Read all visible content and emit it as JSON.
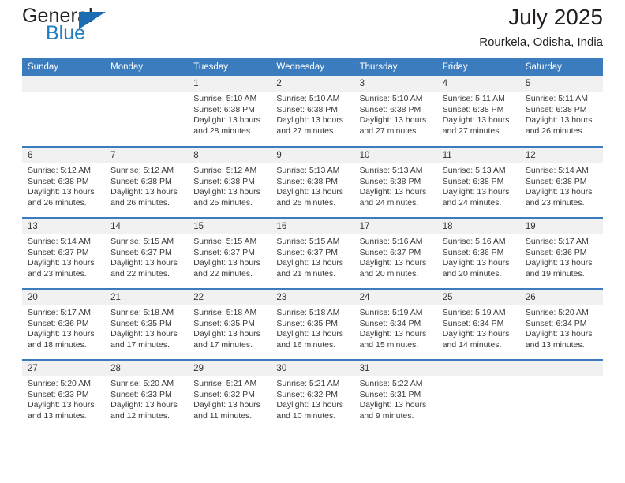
{
  "brand": {
    "name_top": "General",
    "name_bottom": "Blue",
    "triangle_color": "#1b6cb0",
    "blue_text_color": "#1f7dc0"
  },
  "header": {
    "title": "July 2025",
    "subtitle": "Rourkela, Odisha, India"
  },
  "theme": {
    "header_bg": "#3a7cbe",
    "daynum_bg": "#f1f1f1",
    "row_divider": "#3a7cbe",
    "text": "#3a3a3a"
  },
  "weekdays": [
    "Sunday",
    "Monday",
    "Tuesday",
    "Wednesday",
    "Thursday",
    "Friday",
    "Saturday"
  ],
  "weeks": [
    [
      {
        "day": "",
        "empty": true
      },
      {
        "day": "",
        "empty": true
      },
      {
        "day": "1",
        "sunrise": "Sunrise: 5:10 AM",
        "sunset": "Sunset: 6:38 PM",
        "daylight1": "Daylight: 13 hours",
        "daylight2": "and 28 minutes."
      },
      {
        "day": "2",
        "sunrise": "Sunrise: 5:10 AM",
        "sunset": "Sunset: 6:38 PM",
        "daylight1": "Daylight: 13 hours",
        "daylight2": "and 27 minutes."
      },
      {
        "day": "3",
        "sunrise": "Sunrise: 5:10 AM",
        "sunset": "Sunset: 6:38 PM",
        "daylight1": "Daylight: 13 hours",
        "daylight2": "and 27 minutes."
      },
      {
        "day": "4",
        "sunrise": "Sunrise: 5:11 AM",
        "sunset": "Sunset: 6:38 PM",
        "daylight1": "Daylight: 13 hours",
        "daylight2": "and 27 minutes."
      },
      {
        "day": "5",
        "sunrise": "Sunrise: 5:11 AM",
        "sunset": "Sunset: 6:38 PM",
        "daylight1": "Daylight: 13 hours",
        "daylight2": "and 26 minutes."
      }
    ],
    [
      {
        "day": "6",
        "sunrise": "Sunrise: 5:12 AM",
        "sunset": "Sunset: 6:38 PM",
        "daylight1": "Daylight: 13 hours",
        "daylight2": "and 26 minutes."
      },
      {
        "day": "7",
        "sunrise": "Sunrise: 5:12 AM",
        "sunset": "Sunset: 6:38 PM",
        "daylight1": "Daylight: 13 hours",
        "daylight2": "and 26 minutes."
      },
      {
        "day": "8",
        "sunrise": "Sunrise: 5:12 AM",
        "sunset": "Sunset: 6:38 PM",
        "daylight1": "Daylight: 13 hours",
        "daylight2": "and 25 minutes."
      },
      {
        "day": "9",
        "sunrise": "Sunrise: 5:13 AM",
        "sunset": "Sunset: 6:38 PM",
        "daylight1": "Daylight: 13 hours",
        "daylight2": "and 25 minutes."
      },
      {
        "day": "10",
        "sunrise": "Sunrise: 5:13 AM",
        "sunset": "Sunset: 6:38 PM",
        "daylight1": "Daylight: 13 hours",
        "daylight2": "and 24 minutes."
      },
      {
        "day": "11",
        "sunrise": "Sunrise: 5:13 AM",
        "sunset": "Sunset: 6:38 PM",
        "daylight1": "Daylight: 13 hours",
        "daylight2": "and 24 minutes."
      },
      {
        "day": "12",
        "sunrise": "Sunrise: 5:14 AM",
        "sunset": "Sunset: 6:38 PM",
        "daylight1": "Daylight: 13 hours",
        "daylight2": "and 23 minutes."
      }
    ],
    [
      {
        "day": "13",
        "sunrise": "Sunrise: 5:14 AM",
        "sunset": "Sunset: 6:37 PM",
        "daylight1": "Daylight: 13 hours",
        "daylight2": "and 23 minutes."
      },
      {
        "day": "14",
        "sunrise": "Sunrise: 5:15 AM",
        "sunset": "Sunset: 6:37 PM",
        "daylight1": "Daylight: 13 hours",
        "daylight2": "and 22 minutes."
      },
      {
        "day": "15",
        "sunrise": "Sunrise: 5:15 AM",
        "sunset": "Sunset: 6:37 PM",
        "daylight1": "Daylight: 13 hours",
        "daylight2": "and 22 minutes."
      },
      {
        "day": "16",
        "sunrise": "Sunrise: 5:15 AM",
        "sunset": "Sunset: 6:37 PM",
        "daylight1": "Daylight: 13 hours",
        "daylight2": "and 21 minutes."
      },
      {
        "day": "17",
        "sunrise": "Sunrise: 5:16 AM",
        "sunset": "Sunset: 6:37 PM",
        "daylight1": "Daylight: 13 hours",
        "daylight2": "and 20 minutes."
      },
      {
        "day": "18",
        "sunrise": "Sunrise: 5:16 AM",
        "sunset": "Sunset: 6:36 PM",
        "daylight1": "Daylight: 13 hours",
        "daylight2": "and 20 minutes."
      },
      {
        "day": "19",
        "sunrise": "Sunrise: 5:17 AM",
        "sunset": "Sunset: 6:36 PM",
        "daylight1": "Daylight: 13 hours",
        "daylight2": "and 19 minutes."
      }
    ],
    [
      {
        "day": "20",
        "sunrise": "Sunrise: 5:17 AM",
        "sunset": "Sunset: 6:36 PM",
        "daylight1": "Daylight: 13 hours",
        "daylight2": "and 18 minutes."
      },
      {
        "day": "21",
        "sunrise": "Sunrise: 5:18 AM",
        "sunset": "Sunset: 6:35 PM",
        "daylight1": "Daylight: 13 hours",
        "daylight2": "and 17 minutes."
      },
      {
        "day": "22",
        "sunrise": "Sunrise: 5:18 AM",
        "sunset": "Sunset: 6:35 PM",
        "daylight1": "Daylight: 13 hours",
        "daylight2": "and 17 minutes."
      },
      {
        "day": "23",
        "sunrise": "Sunrise: 5:18 AM",
        "sunset": "Sunset: 6:35 PM",
        "daylight1": "Daylight: 13 hours",
        "daylight2": "and 16 minutes."
      },
      {
        "day": "24",
        "sunrise": "Sunrise: 5:19 AM",
        "sunset": "Sunset: 6:34 PM",
        "daylight1": "Daylight: 13 hours",
        "daylight2": "and 15 minutes."
      },
      {
        "day": "25",
        "sunrise": "Sunrise: 5:19 AM",
        "sunset": "Sunset: 6:34 PM",
        "daylight1": "Daylight: 13 hours",
        "daylight2": "and 14 minutes."
      },
      {
        "day": "26",
        "sunrise": "Sunrise: 5:20 AM",
        "sunset": "Sunset: 6:34 PM",
        "daylight1": "Daylight: 13 hours",
        "daylight2": "and 13 minutes."
      }
    ],
    [
      {
        "day": "27",
        "sunrise": "Sunrise: 5:20 AM",
        "sunset": "Sunset: 6:33 PM",
        "daylight1": "Daylight: 13 hours",
        "daylight2": "and 13 minutes."
      },
      {
        "day": "28",
        "sunrise": "Sunrise: 5:20 AM",
        "sunset": "Sunset: 6:33 PM",
        "daylight1": "Daylight: 13 hours",
        "daylight2": "and 12 minutes."
      },
      {
        "day": "29",
        "sunrise": "Sunrise: 5:21 AM",
        "sunset": "Sunset: 6:32 PM",
        "daylight1": "Daylight: 13 hours",
        "daylight2": "and 11 minutes."
      },
      {
        "day": "30",
        "sunrise": "Sunrise: 5:21 AM",
        "sunset": "Sunset: 6:32 PM",
        "daylight1": "Daylight: 13 hours",
        "daylight2": "and 10 minutes."
      },
      {
        "day": "31",
        "sunrise": "Sunrise: 5:22 AM",
        "sunset": "Sunset: 6:31 PM",
        "daylight1": "Daylight: 13 hours",
        "daylight2": "and 9 minutes."
      },
      {
        "day": "",
        "empty": true
      },
      {
        "day": "",
        "empty": true
      }
    ]
  ]
}
